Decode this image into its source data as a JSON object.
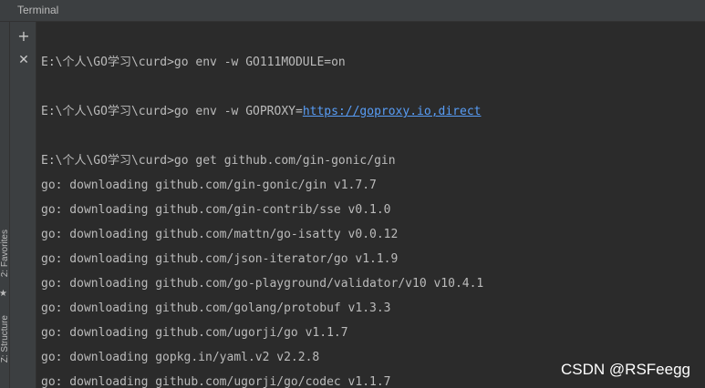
{
  "window": {
    "title": "Terminal"
  },
  "side_tabs": {
    "favorites": "2: Favorites",
    "structure": "Z: Structure"
  },
  "toolbar": {
    "new_session_glyph": "+",
    "close_session_glyph": "✕",
    "new_session_icon": "plus-icon",
    "close_session_icon": "close-icon"
  },
  "terminal": {
    "prompt": "E:\\个人\\GO学习\\curd>",
    "commands": [
      {
        "text": "go env -w GO111MODULE=on"
      },
      {
        "text": "go env -w GOPROXY=",
        "link": "https://goproxy.io,direct"
      },
      {
        "text": "go get github.com/gin-gonic/gin"
      }
    ],
    "output": [
      "go: downloading github.com/gin-gonic/gin v1.7.7",
      "go: downloading github.com/gin-contrib/sse v0.1.0",
      "go: downloading github.com/mattn/go-isatty v0.0.12",
      "go: downloading github.com/json-iterator/go v1.1.9",
      "go: downloading github.com/go-playground/validator/v10 v10.4.1",
      "go: downloading github.com/golang/protobuf v1.3.3",
      "go: downloading github.com/ugorji/go v1.1.7",
      "go: downloading gopkg.in/yaml.v2 v2.2.8",
      "go: downloading github.com/ugorji/go/codec v1.1.7"
    ]
  },
  "watermark": "CSDN @RSFeegg",
  "colors": {
    "background": "#2b2b2b",
    "panel": "#3c3f41",
    "text": "#bbbbbb",
    "link": "#589df6"
  }
}
